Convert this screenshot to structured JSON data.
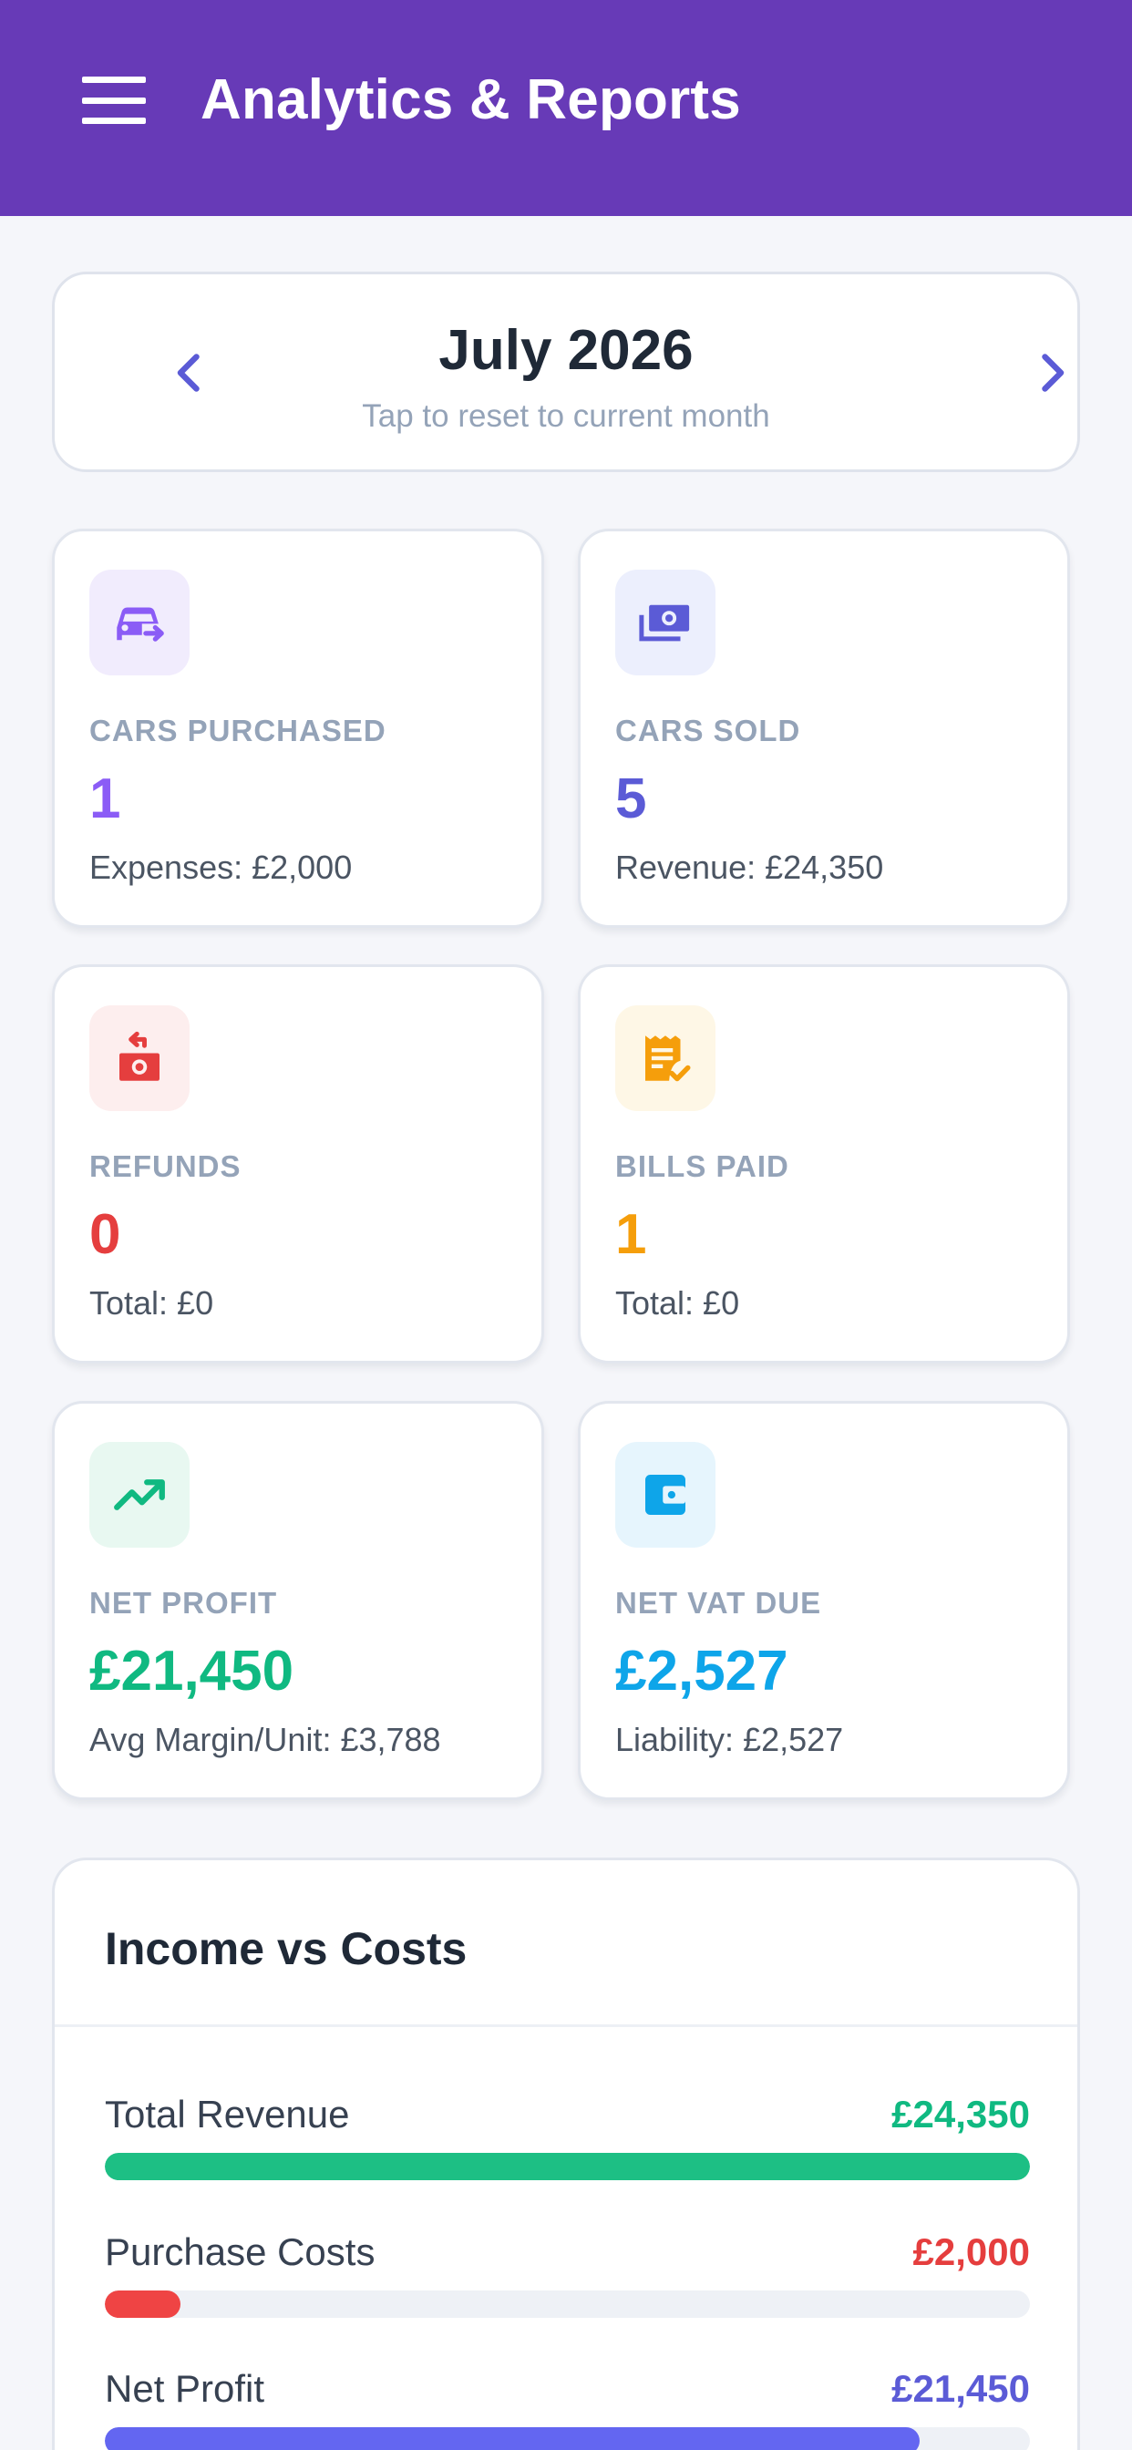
{
  "app_bar": {
    "title": "Analytics & Reports",
    "menu_icon": "menu-icon",
    "background": "#673ab7"
  },
  "month_selector": {
    "month": "July 2026",
    "hint": "Tap to reset to current month",
    "prev_icon": "chevron-left-icon",
    "next_icon": "chevron-right-icon",
    "arrow_color": "#5b5bd6"
  },
  "stats": [
    {
      "label": "CARS PURCHASED",
      "value": "1",
      "sub": "Expenses: £2,000",
      "icon": "car-arrow-icon",
      "color": "#8b5cf6",
      "icon_bg": "#f1ecfd"
    },
    {
      "label": "CARS SOLD",
      "value": "5",
      "sub": "Revenue: £24,350",
      "icon": "banknotes-icon",
      "color": "#5b5bd6",
      "icon_bg": "#eceffd"
    },
    {
      "label": "REFUNDS",
      "value": "0",
      "sub": "Total: £0",
      "icon": "money-return-icon",
      "color": "#e53e3e",
      "icon_bg": "#fdeeee"
    },
    {
      "label": "BILLS PAID",
      "value": "1",
      "sub": "Total: £0",
      "icon": "receipt-check-icon",
      "color": "#f59e0b",
      "icon_bg": "#fef7e6"
    },
    {
      "label": "NET PROFIT",
      "value": "£21,450",
      "sub": "Avg Margin/Unit: £3,788",
      "icon": "trending-up-icon",
      "color": "#10b981",
      "icon_bg": "#e8f8f1"
    },
    {
      "label": "NET VAT DUE",
      "value": "£2,527",
      "sub": "Liability: £2,527",
      "icon": "wallet-icon",
      "color": "#0ea5e9",
      "icon_bg": "#e6f5fd"
    }
  ],
  "income_vs_costs": {
    "title": "Income vs Costs",
    "rows": [
      {
        "label": "Total Revenue",
        "amount": "£24,350",
        "color": "#10b981",
        "bar_color": "#1dbf84",
        "fill_fraction": 1.0
      },
      {
        "label": "Purchase Costs",
        "amount": "£2,000",
        "color": "#e53e3e",
        "bar_color": "#ef4444",
        "fill_fraction": 0.082
      },
      {
        "label": "Net Profit",
        "amount": "£21,450",
        "color": "#5b5bd6",
        "bar_color": "#6366f1",
        "fill_fraction": 0.881
      }
    ]
  }
}
